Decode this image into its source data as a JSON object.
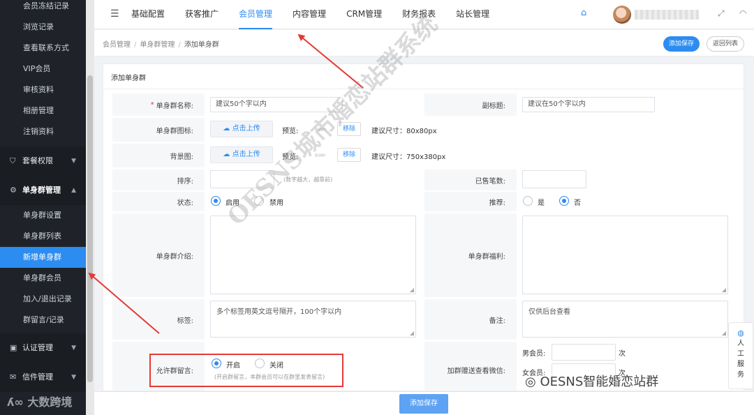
{
  "sidebar": {
    "top_items": [
      "会员冻结记录",
      "浏览记录",
      "查看联系方式",
      "VIP会员",
      "审核资料",
      "相册管理",
      "注销资料"
    ],
    "group_package": "套餐权限",
    "group_singles": "单身群管理",
    "singles_items": [
      "单身群设置",
      "单身群列表",
      "新增单身群",
      "单身群会员",
      "加入/退出记录",
      "群留言/记录"
    ],
    "group_auth": "认证管理",
    "group_mail": "信件管理"
  },
  "topnav": {
    "items": [
      "基础配置",
      "获客推广",
      "会员管理",
      "内容管理",
      "CRM管理",
      "财务报表",
      "站长管理"
    ],
    "active": "会员管理"
  },
  "breadcrumb": [
    "会员管理",
    "单身群管理",
    "添加单身群"
  ],
  "actions": {
    "save": "添加保存",
    "back": "返回列表"
  },
  "card": {
    "title": "添加单身群"
  },
  "form": {
    "name_label": "单身群名称:",
    "name_placeholder": "建议50个字以内",
    "subtitle_label": "副标题:",
    "subtitle_placeholder": "建议在50个字以内",
    "icon_label": "单身群图标:",
    "upload_text": "点击上传",
    "preview_label": "预览:",
    "preview_tiny": "暂无图片",
    "remove_text": "移除",
    "icon_size": "建议尺寸：80x80px",
    "bg_label": "背景图:",
    "bg_size": "建议尺寸：750x380px",
    "sort_label": "排序:",
    "sort_hint": "(数字越大，越靠前)",
    "sold_label": "已售笔数:",
    "status_label": "状态:",
    "status_on": "启用",
    "status_off": "禁用",
    "recommend_label": "推荐:",
    "recommend_yes": "是",
    "recommend_no": "否",
    "intro_label": "单身群介绍:",
    "welfare_label": "单身群福利:",
    "tags_label": "标签:",
    "tags_placeholder": "多个标签用英文逗号隔开，100个字以内",
    "note_label": "备注:",
    "note_placeholder": "仅供后台查看",
    "allow_msg_label": "允许群留言:",
    "allow_on": "开启",
    "allow_off": "关闭",
    "allow_hint": "(开启群留言，本群会员可以在群里发表留言)",
    "wechat_label": "加群赠送查看微信:",
    "male_label": "男会员:",
    "female_label": "女会员:",
    "times_unit": "次"
  },
  "float_service": [
    "人",
    "工",
    "服",
    "务"
  ],
  "watermarks": {
    "main": "OESNS城市婚恋站群系统",
    "corner": "大数跨境",
    "right": "OESNS智能婚恋站群"
  },
  "colors": {
    "accent": "#2d8cf0",
    "sidebar": "#1f2329",
    "annotation": "#e53935"
  }
}
